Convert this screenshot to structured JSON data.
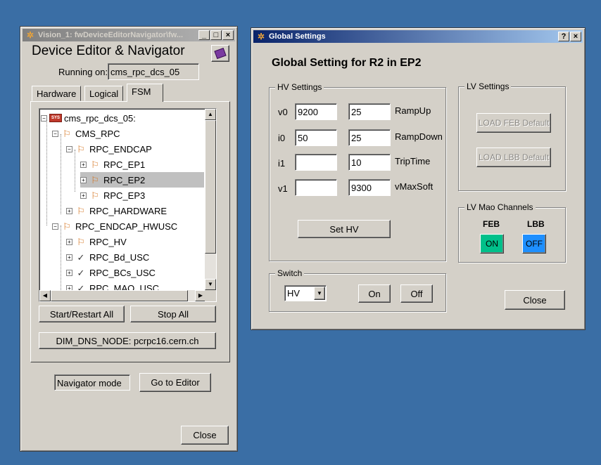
{
  "navigator": {
    "title": "Vision_1: fwDeviceEditorNavigator\\fw...",
    "heading": "Device Editor & Navigator",
    "running_on_label": "Running on:",
    "running_on_value": "cms_rpc_dcs_05",
    "tabs": [
      "Hardware",
      "Logical",
      "FSM"
    ],
    "tree": [
      {
        "label": "cms_rpc_dcs_05:",
        "icon": "system-icon"
      },
      {
        "label": "CMS_RPC",
        "icon": "fsm-node-icon"
      },
      {
        "label": "RPC_ENDCAP",
        "icon": "fsm-node-icon"
      },
      {
        "label": "RPC_EP1",
        "icon": "fsm-node-icon"
      },
      {
        "label": "RPC_EP2",
        "icon": "fsm-node-icon"
      },
      {
        "label": "RPC_EP3",
        "icon": "fsm-node-icon"
      },
      {
        "label": "RPC_HARDWARE",
        "icon": "fsm-node-icon"
      },
      {
        "label": "RPC_ENDCAP_HWUSC",
        "icon": "fsm-node-icon"
      },
      {
        "label": "RPC_HV",
        "icon": "fsm-node-icon"
      },
      {
        "label": "RPC_Bd_USC",
        "icon": "device-unit-icon"
      },
      {
        "label": "RPC_BCs_USC",
        "icon": "device-unit-icon"
      },
      {
        "label": "RPC_MAO_USC",
        "icon": "device-unit-icon"
      }
    ],
    "start_restart_label": "Start/Restart All",
    "stop_all_label": "Stop All",
    "dim_dns_label": "DIM_DNS_NODE: pcrpc16.cern.ch",
    "mode_label": "Navigator mode",
    "go_to_editor_label": "Go to Editor",
    "close_label": "Close"
  },
  "global": {
    "title": "Global Settings",
    "heading": "Global Setting for R2 in EP2",
    "hv_group_label": "HV Settings",
    "hv_rows": [
      {
        "label": "v0",
        "value": "9200",
        "value2": "25",
        "param": "RampUp"
      },
      {
        "label": "i0",
        "value": "50",
        "value2": "25",
        "param": "RampDown"
      },
      {
        "label": "i1",
        "value": "",
        "value2": "10",
        "param": "TripTime"
      },
      {
        "label": "v1",
        "value": "",
        "value2": "9300",
        "param": "vMaxSoft"
      }
    ],
    "set_hv_label": "Set HV",
    "switch_group_label": "Switch",
    "switch_selected": "HV",
    "on_label": "On",
    "off_label": "Off",
    "lv_group_label": "LV Settings",
    "load_feb_label": "LOAD FEB Default",
    "load_lbb_label": "LOAD LBB Default",
    "mao_group_label": "LV Mao Channels",
    "feb_label": "FEB",
    "lbb_label": "LBB",
    "feb_state": "ON",
    "lbb_state": "OFF",
    "close_label": "Close",
    "colors": {
      "feb_on": "#00c08a",
      "lbb_off": "#1e8fff"
    }
  }
}
